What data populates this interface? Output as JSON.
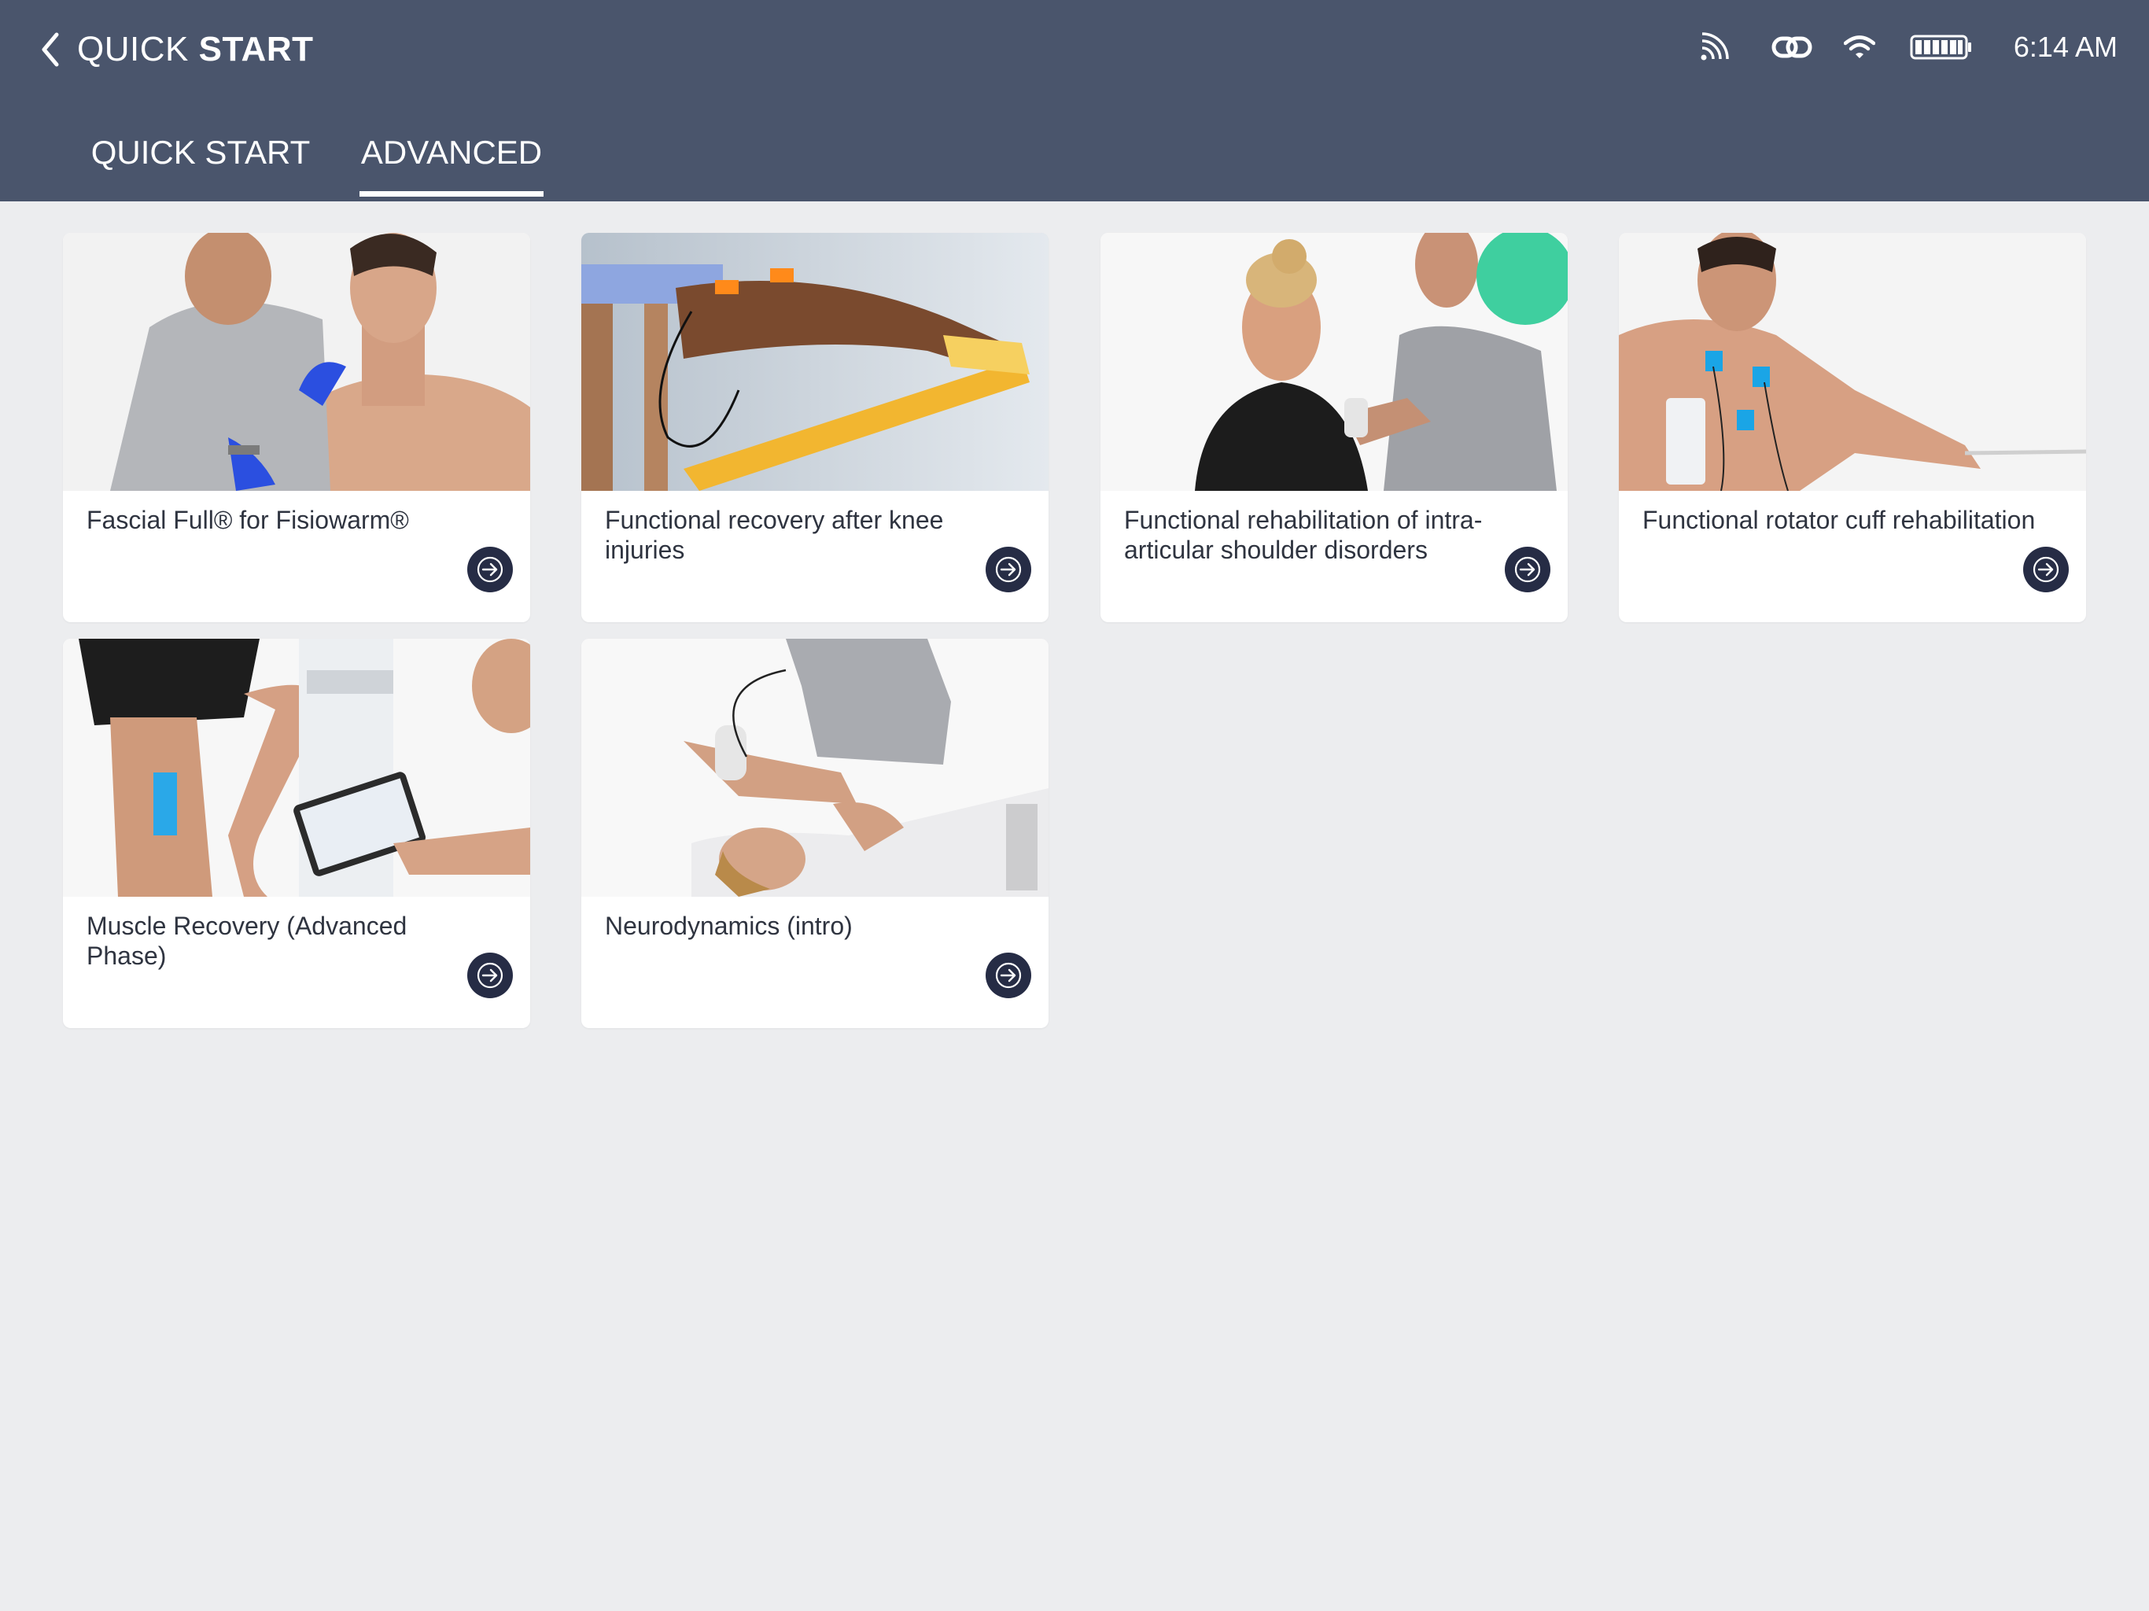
{
  "header": {
    "back_icon": "chevron-left-icon",
    "title_part1": "QUICK",
    "title_part2": "START"
  },
  "status_bar": {
    "icons": [
      "signal-feed-icon",
      "link-icon",
      "wifi-icon",
      "battery-icon"
    ],
    "time": "6:14 AM",
    "battery_level": 1.0
  },
  "tabs": [
    {
      "label": "QUICK START",
      "active": false
    },
    {
      "label": "ADVANCED",
      "active": true
    }
  ],
  "cards": [
    {
      "title": "Fascial Full® for Fisiowarm®",
      "image": "therapist-shoulder-photo"
    },
    {
      "title": "Functional recovery after knee injuries",
      "image": "leg-elastic-band-photo"
    },
    {
      "title": "Functional rehabilitation of intra-articular shoulder disorders",
      "image": "shoulder-ball-photo"
    },
    {
      "title": "Functional rotator cuff rehabilitation",
      "image": "back-electrodes-photo"
    },
    {
      "title": "Muscle Recovery (Advanced Phase)",
      "image": "calf-tablet-photo"
    },
    {
      "title": "Neurodynamics (intro)",
      "image": "neck-treatment-photo"
    }
  ],
  "colors": {
    "header_bg": "#4a556c",
    "page_bg": "#ecedef",
    "arrow_button": "#262c45"
  }
}
